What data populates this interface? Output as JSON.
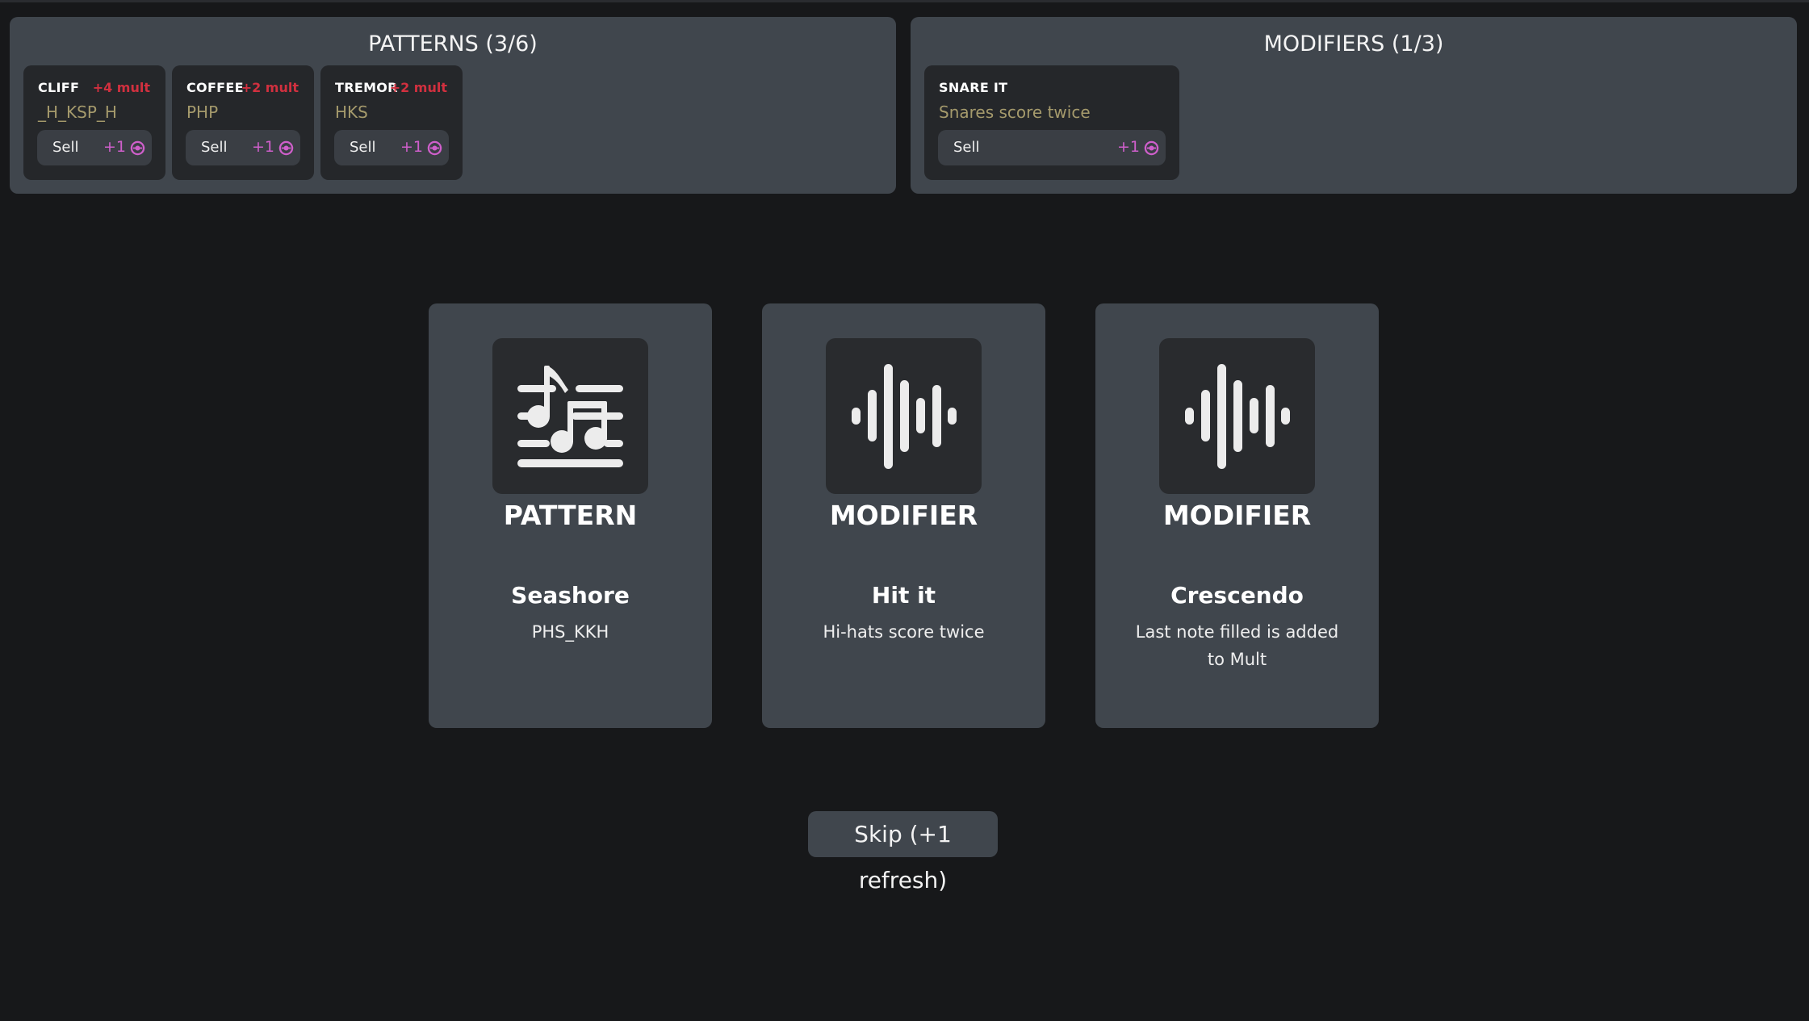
{
  "patterns_panel": {
    "title": "PATTERNS (3/6)",
    "items": [
      {
        "name": "CLIFF",
        "mult": "+4 mult",
        "sequence": "_H_KSP_H",
        "sell_label": "Sell",
        "sell_value": "+1"
      },
      {
        "name": "COFFEE",
        "mult": "+2 mult",
        "sequence": "PHP",
        "sell_label": "Sell",
        "sell_value": "+1"
      },
      {
        "name": "TREMOR",
        "mult": "+2 mult",
        "sequence": "HKS",
        "sell_label": "Sell",
        "sell_value": "+1"
      }
    ]
  },
  "modifiers_panel": {
    "title": "MODIFIERS (1/3)",
    "items": [
      {
        "name": "SNARE IT",
        "description": "Snares score twice",
        "sell_label": "Sell",
        "sell_value": "+1"
      }
    ]
  },
  "offers": [
    {
      "type": "PATTERN",
      "icon": "music-notes-sliders-icon",
      "name": "Seashore",
      "description": "PHS_KKH"
    },
    {
      "type": "MODIFIER",
      "icon": "sound-wave-icon",
      "name": "Hit it",
      "description": "Hi-hats score twice"
    },
    {
      "type": "MODIFIER",
      "icon": "sound-wave-icon",
      "name": "Crescendo",
      "description": "Last note filled is added to Mult"
    }
  ],
  "skip_button": {
    "label": "Skip (+1 refresh)"
  },
  "colors": {
    "background": "#17181a",
    "panel": "#40464d",
    "card_dark": "#25272a",
    "mult_red": "#d1303f",
    "sequence_gold": "#a59a6c",
    "coin_purple": "#cf5fcb"
  }
}
